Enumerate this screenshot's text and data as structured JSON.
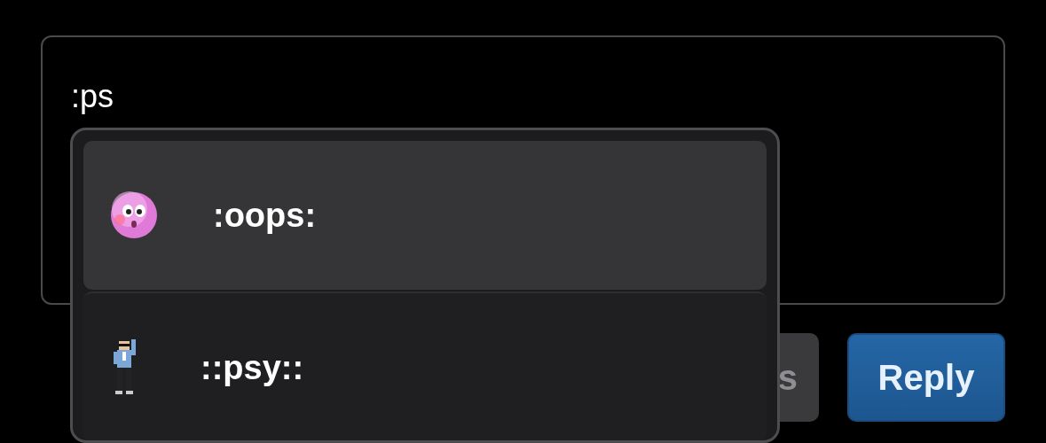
{
  "composer": {
    "value": ":ps"
  },
  "suggestions": [
    {
      "code": ":oops:",
      "selected": true
    },
    {
      "code": "::psy::",
      "selected": false
    }
  ],
  "buttons": [
    {
      "label": "s",
      "kind": "secondary"
    },
    {
      "label": "Reply",
      "kind": "primary"
    }
  ]
}
